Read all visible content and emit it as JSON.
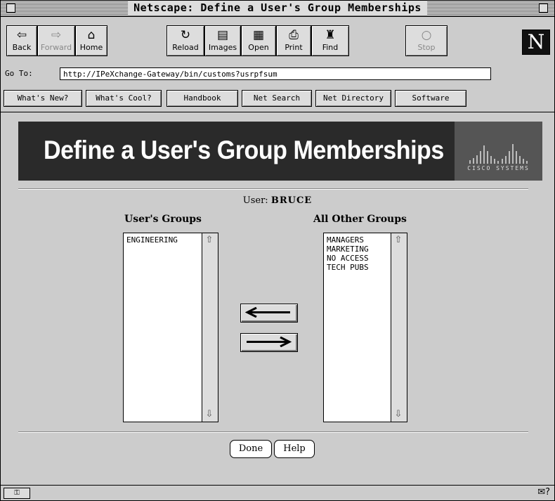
{
  "window": {
    "title": "Netscape: Define a User's Group Memberships"
  },
  "toolbar": {
    "buttons": [
      {
        "label": "Back",
        "icon": "back-arrow-icon"
      },
      {
        "label": "Forward",
        "icon": "forward-arrow-icon"
      },
      {
        "label": "Home",
        "icon": "house-icon"
      },
      {
        "label": "Reload",
        "icon": "reload-icon"
      },
      {
        "label": "Images",
        "icon": "images-icon"
      },
      {
        "label": "Open",
        "icon": "open-icon"
      },
      {
        "label": "Print",
        "icon": "printer-icon"
      },
      {
        "label": "Find",
        "icon": "binoculars-icon"
      },
      {
        "label": "Stop",
        "icon": "stop-icon"
      }
    ],
    "logo": "N"
  },
  "location": {
    "label": "Go To:",
    "url": "http://IPeXchange-Gateway/bin/customs?usrpfsum"
  },
  "directory_buttons": [
    "What's New?",
    "What's Cool?",
    "Handbook",
    "Net Search",
    "Net Directory",
    "Software"
  ],
  "page": {
    "banner_title": "Define a User's Group Memberships",
    "banner_logo": "CISCO SYSTEMS",
    "user_label": "User:",
    "user_name": "BRUCE",
    "users_groups_heading": "User's Groups",
    "other_groups_heading": "All Other Groups",
    "users_groups": [
      "ENGINEERING"
    ],
    "other_groups": [
      "MANAGERS",
      "MARKETING",
      "NO ACCESS",
      "TECH PUBS"
    ],
    "done_label": "Done",
    "help_label": "Help"
  },
  "colors": {
    "banner_bg": "#2a2a2a",
    "window_bg": "#cccccc"
  }
}
